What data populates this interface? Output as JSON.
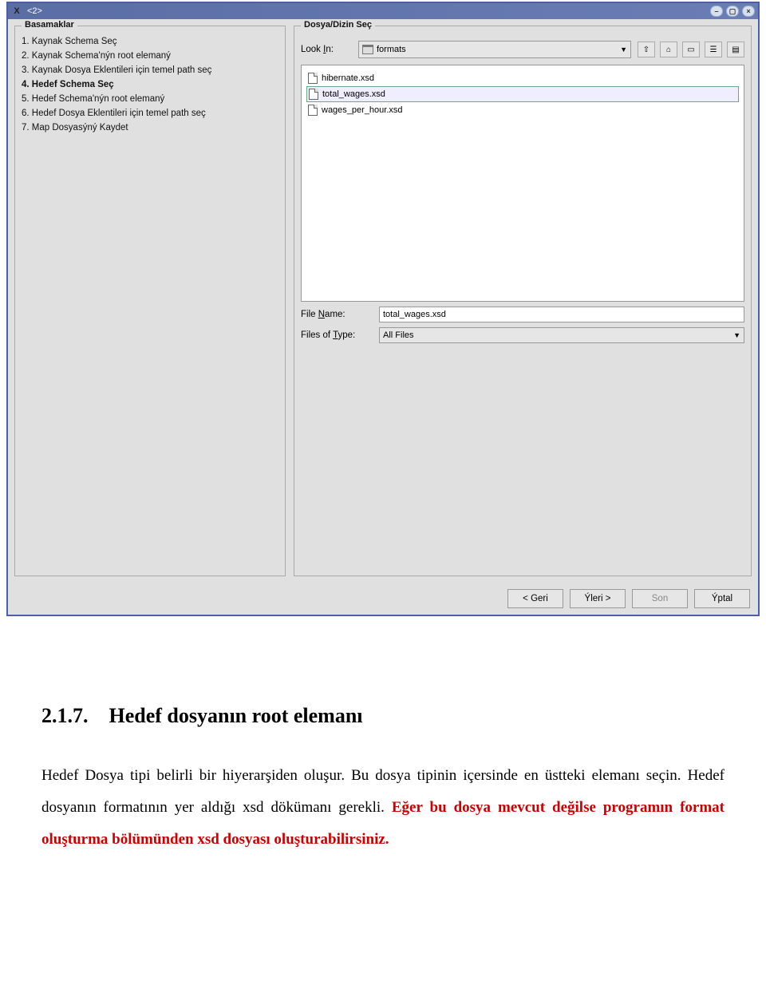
{
  "window_title": "<2>",
  "steps_legend": "Basamaklar",
  "chooser_legend": "Dosya/Dizin Seç",
  "steps": [
    {
      "label": "1. Kaynak Schema Seç",
      "current": false
    },
    {
      "label": "2. Kaynak Schema'nýn root elemaný",
      "current": false
    },
    {
      "label": "3. Kaynak Dosya Eklentileri için temel path seç",
      "current": false
    },
    {
      "label": "4. Hedef Schema Seç",
      "current": true
    },
    {
      "label": "5. Hedef Schema'nýn root elemaný",
      "current": false
    },
    {
      "label": "6. Hedef Dosya Eklentileri için temel path seç",
      "current": false
    },
    {
      "label": "7. Map Dosyasýný Kaydet",
      "current": false
    }
  ],
  "lookin_label": "Look In:",
  "lookin_value": "formats",
  "files": [
    {
      "name": "hibernate.xsd",
      "selected": false
    },
    {
      "name": "total_wages.xsd",
      "selected": true
    },
    {
      "name": "wages_per_hour.xsd",
      "selected": false
    }
  ],
  "filename_label": "File Name:",
  "filename_value": "total_wages.xsd",
  "filetype_label": "Files of Type:",
  "filetype_value": "All Files",
  "buttons": {
    "back": "< Geri",
    "next": "Ýleri >",
    "finish": "Son",
    "cancel": "Ýptal"
  },
  "document": {
    "heading_num": "2.1.7.",
    "heading_title": "Hedef dosyanın root elemanı",
    "para_black1": "Hedef Dosya tipi belirli bir hiyerarşiden oluşur. Bu dosya tipinin içersinde en üstteki elemanı seçin. Hedef dosyanın formatının yer aldığı xsd dökümanı gerekli. ",
    "para_red": "Eğer bu dosya mevcut değilse programın format oluşturma bölümünden xsd dosyası oluşturabilirsiniz."
  }
}
